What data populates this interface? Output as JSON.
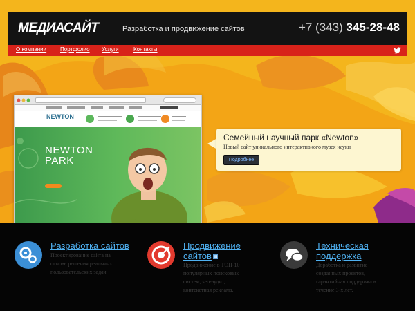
{
  "header": {
    "logo": "МЕДИАСАЙТ",
    "tagline": "Разработка и продвижение сайтов",
    "phone_prefix": "+7 (343)",
    "phone_number": "345-28-48"
  },
  "nav": {
    "items": [
      {
        "label": "О компании"
      },
      {
        "label": "Портфолио"
      },
      {
        "label": "Услуги"
      },
      {
        "label": "Контакты"
      }
    ],
    "social_icon": "twitter-icon"
  },
  "showcase": {
    "mockup_logo": "NEWTON",
    "mockup_title_line1": "NEWTON",
    "mockup_title_line2": "PARK",
    "callout_title": "Семейный научный парк «Newton»",
    "callout_subtitle": "Новый сайт уникального интерактивного музея науки",
    "callout_button": "Подробнее"
  },
  "services": [
    {
      "icon": "gears-icon",
      "title": "Разработка сайтов",
      "text": [
        "Проектирование сайта на",
        "основе решения реальных",
        "пользовательских задач."
      ]
    },
    {
      "icon": "target-icon",
      "title_line1": "Продвижение",
      "title_line2": "сайтов",
      "text": [
        "Продвижение в ТОП-10",
        "популярных поисковых",
        "систем, seo-аудит,",
        "контекстная реклама."
      ]
    },
    {
      "icon": "chat-icon",
      "title_line1": "Техническая",
      "title_line2": "поддержка",
      "text": [
        "Доработка и развитие",
        "созданных проектов,",
        "гарантийная поддержка в",
        "течение 3-х лет."
      ]
    }
  ],
  "colors": {
    "accent_red": "#d8221a",
    "background_orange": "#f2a218",
    "link_blue": "#4fb0f0",
    "header_black": "#131313"
  }
}
